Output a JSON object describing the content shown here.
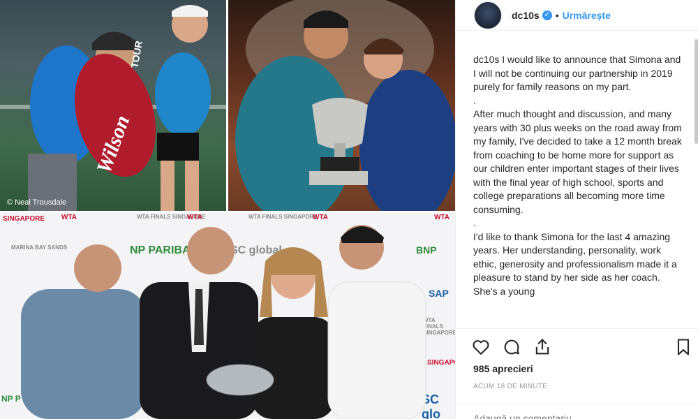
{
  "photos": {
    "credit": "© Neal Trousdale",
    "bag_brand": "Wilson",
    "bag_side_text": "TOUR",
    "sponsor_logos": [
      "SINGAPORE",
      "WTA",
      "WTA FINALS SINGAPORE",
      "WTA",
      "WTA FINALS SINGAPORE",
      "WTA",
      "WTA",
      "MARINA BAY SANDS",
      "NP PARIBAS",
      "SC global",
      "BNP",
      "SAP",
      "WTA FINALS SINGAPORE",
      "SINGAPORE",
      "SC glo",
      "NP P",
      "obal"
    ]
  },
  "post": {
    "username": "dc10s",
    "verified_icon": "verified-badge-icon",
    "separator": "•",
    "follow_label": "Urmărește",
    "caption_username": "dc10s",
    "caption_lines": [
      "I would like to announce that Simona and I will not be continuing our partnership in 2019 purely for family reasons on my part.",
      ".",
      "After much thought and discussion, and many years with 30 plus weeks on the road away from my family, I've decided to take a 12 month break from coaching to be home more for support as our children enter important stages of their lives with the final year of high school, sports and college preparations all becoming more time consuming.",
      ".",
      "I'd like to thank Simona for the last 4 amazing years. Her understanding, personality, work ethic, generosity and professionalism made it a pleasure to stand by her side as her coach. She's a young"
    ],
    "likes": "985 aprecieri",
    "time_ago": "ACUM 18 DE MINUTE",
    "comment_placeholder": "Adaugă un comentariu..."
  },
  "icons": {
    "like": "heart-icon",
    "comment": "comment-icon",
    "share": "share-icon",
    "save": "bookmark-icon"
  },
  "colors": {
    "accent": "#3897f0",
    "text": "#262626",
    "muted": "#999999",
    "border": "#efefef"
  }
}
